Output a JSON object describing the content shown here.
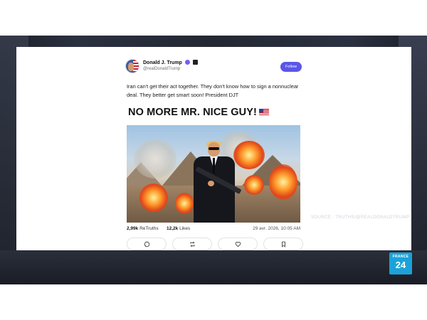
{
  "post": {
    "display_name": "Donald J. Trump",
    "handle": "@realDonaldTrump",
    "follow_label": "Follow",
    "text": "Iran can't get their act together. They don't know how to sign a nonnuclear deal. They better get smart soon! President DJT",
    "image_headline": "NO MORE MR. NICE GUY!",
    "flag_icon": "us-flag-icon"
  },
  "stats": {
    "retruths_count": "2,99k",
    "retruths_label": "ReTruths",
    "likes_count": "12,2k",
    "likes_label": "Likes",
    "timestamp": "29 avr. 2026, 10:05 AM"
  },
  "actions": [
    "reply-icon",
    "retruth-icon",
    "like-icon",
    "bookmark-icon"
  ],
  "overlay": {
    "source": "SOURCE : TRUTHS/@REALDONALDTRUMP",
    "logo_top": "FRANCE",
    "logo_bottom": "24"
  },
  "colors": {
    "follow_button": "#5a56e8",
    "verified_badge": "#7a5af8",
    "logo_bg": "#1ba2d9"
  }
}
